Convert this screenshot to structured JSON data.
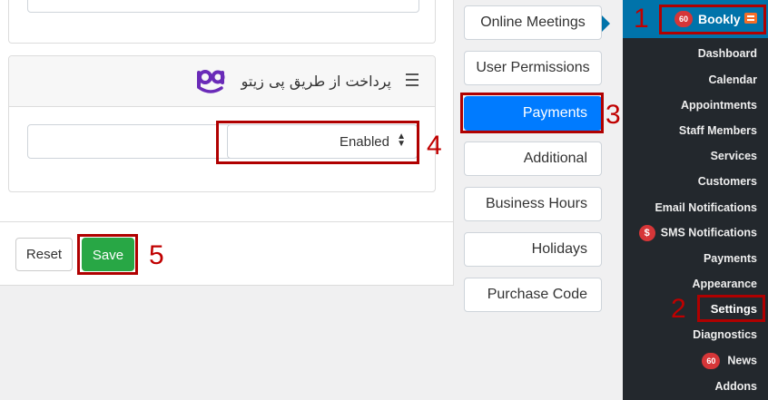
{
  "gateway": {
    "title": "پرداخت از طریق پی زیتو",
    "logo_text": "pa",
    "status_value": "Enabled"
  },
  "buttons": {
    "reset": "Reset",
    "save": "Save"
  },
  "settings_menu": [
    {
      "label": "Online Meetings"
    },
    {
      "label": "User Permissions"
    },
    {
      "label": "Payments",
      "active": true
    },
    {
      "label": "Additional"
    },
    {
      "label": "Business Hours"
    },
    {
      "label": "Holidays"
    },
    {
      "label": "Purchase Code"
    }
  ],
  "sidebar": {
    "plugin": {
      "label": "Bookly",
      "badge": "60"
    },
    "items": [
      {
        "label": "Dashboard"
      },
      {
        "label": "Calendar"
      },
      {
        "label": "Appointments"
      },
      {
        "label": "Staff Members"
      },
      {
        "label": "Services"
      },
      {
        "label": "Customers"
      },
      {
        "label": "Email Notifications"
      },
      {
        "label": "SMS Notifications",
        "badge": "$"
      },
      {
        "label": "Payments"
      },
      {
        "label": "Appearance"
      },
      {
        "label": "Settings",
        "current": true
      },
      {
        "label": "Diagnostics"
      },
      {
        "label": "News",
        "badge": "60"
      },
      {
        "label": "Addons"
      }
    ]
  },
  "annotations": [
    "1",
    "2",
    "3",
    "4",
    "5"
  ],
  "colors": {
    "accent_blue": "#007bff",
    "save_green": "#28a745",
    "sidebar_bg": "#23282d",
    "sidebar_active": "#0073aa",
    "highlight_red": "#b00000",
    "badge_red": "#d63638",
    "logo_purple": "#6a2bb8"
  }
}
